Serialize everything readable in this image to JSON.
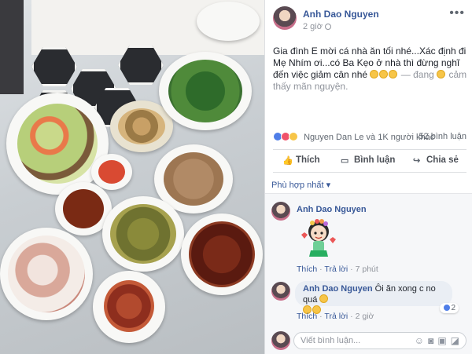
{
  "post": {
    "author": "Anh Dao Nguyen",
    "time": "2 giờ",
    "text_main": "Gia đình E mời cá nhà ăn tối nhé...Xác định đi Mẹ Nhím ơi...có Ba Kẹo ở nhà thì đừng nghĩ đến việc giảm cân nhé",
    "feeling_prefix": " — đang",
    "feeling_text": " cảm thấy mãn nguyện."
  },
  "reactions": {
    "names": "Nguyen Dan Le và 1K người khác",
    "comment_count": "52 bình luận"
  },
  "actions": {
    "like": "Thích",
    "comment": "Bình luận",
    "share": "Chia sẻ"
  },
  "sort_label": "Phù hợp nhất ▾",
  "comments": [
    {
      "author": "Anh Dao Nguyen",
      "like_label": "Thích",
      "reply_label": "Trả lời",
      "time": "7 phút"
    },
    {
      "author": "Anh Dao Nguyen",
      "text": " Ôi ăn xong c no quá",
      "like_label": "Thích",
      "reply_label": "Trả lời",
      "time": "2 giờ",
      "like_count": "2"
    }
  ],
  "composer": {
    "placeholder": "Viết bình luận..."
  },
  "colors": {
    "link": "#385898",
    "like_blue": "#4f7ee8",
    "love_red": "#f0516a",
    "haha_yellow": "#f7c548"
  }
}
